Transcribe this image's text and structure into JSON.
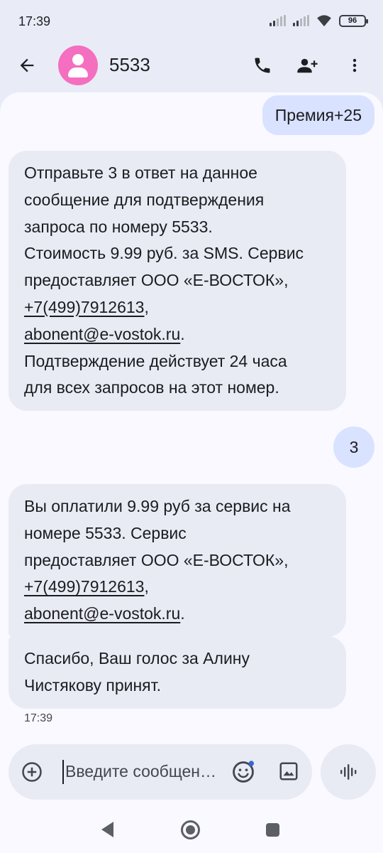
{
  "status_bar": {
    "time": "17:39",
    "battery": "96",
    "icons": [
      "signal-icon",
      "signal-icon",
      "wifi-icon",
      "battery-icon"
    ]
  },
  "app_bar": {
    "contact_name": "5533",
    "avatar_color": "#f46fbf",
    "icons": [
      "back-arrow-icon",
      "phone-icon",
      "add-person-icon",
      "more-vert-icon"
    ]
  },
  "messages": [
    {
      "direction": "out",
      "text": "Премия+25"
    },
    {
      "direction": "in",
      "lines": [
        "Отправьте 3 в ответ на данное",
        "сообщение для подтверждения",
        "запроса по номеру 5533.",
        "Стоимость 9.99 руб. за SMS. Сервис",
        "предоставляет ООО «Е-ВОСТОК»,",
        "+7(499)7912613",
        "abonent@e-vostok.ru",
        "Подтверждение действует 24 часа",
        "для всех запросов на этот номер."
      ]
    },
    {
      "direction": "out",
      "text": "3"
    },
    {
      "direction": "in",
      "lines": [
        "Вы оплатили 9.99 руб за сервис на",
        "номере 5533. Сервис",
        "предоставляет ООО «Е-ВОСТОК»,",
        "+7(499)7912613",
        "abonent@e-vostok.ru"
      ]
    },
    {
      "direction": "in",
      "lines": [
        "Спасибо, Ваш голос за Алину",
        "Чистякову принят."
      ]
    }
  ],
  "message_time": "17:39",
  "compose": {
    "placeholder": "Введите сообщен…",
    "icons": [
      "add-icon",
      "emoji-icon",
      "image-icon",
      "voice-icon"
    ]
  },
  "colors": {
    "header_bg": "#e9ecf6",
    "panel_bg": "#f9f9ff",
    "outgoing_bubble": "#d9e2ff",
    "incoming_bubble": "#e9ebf4"
  }
}
